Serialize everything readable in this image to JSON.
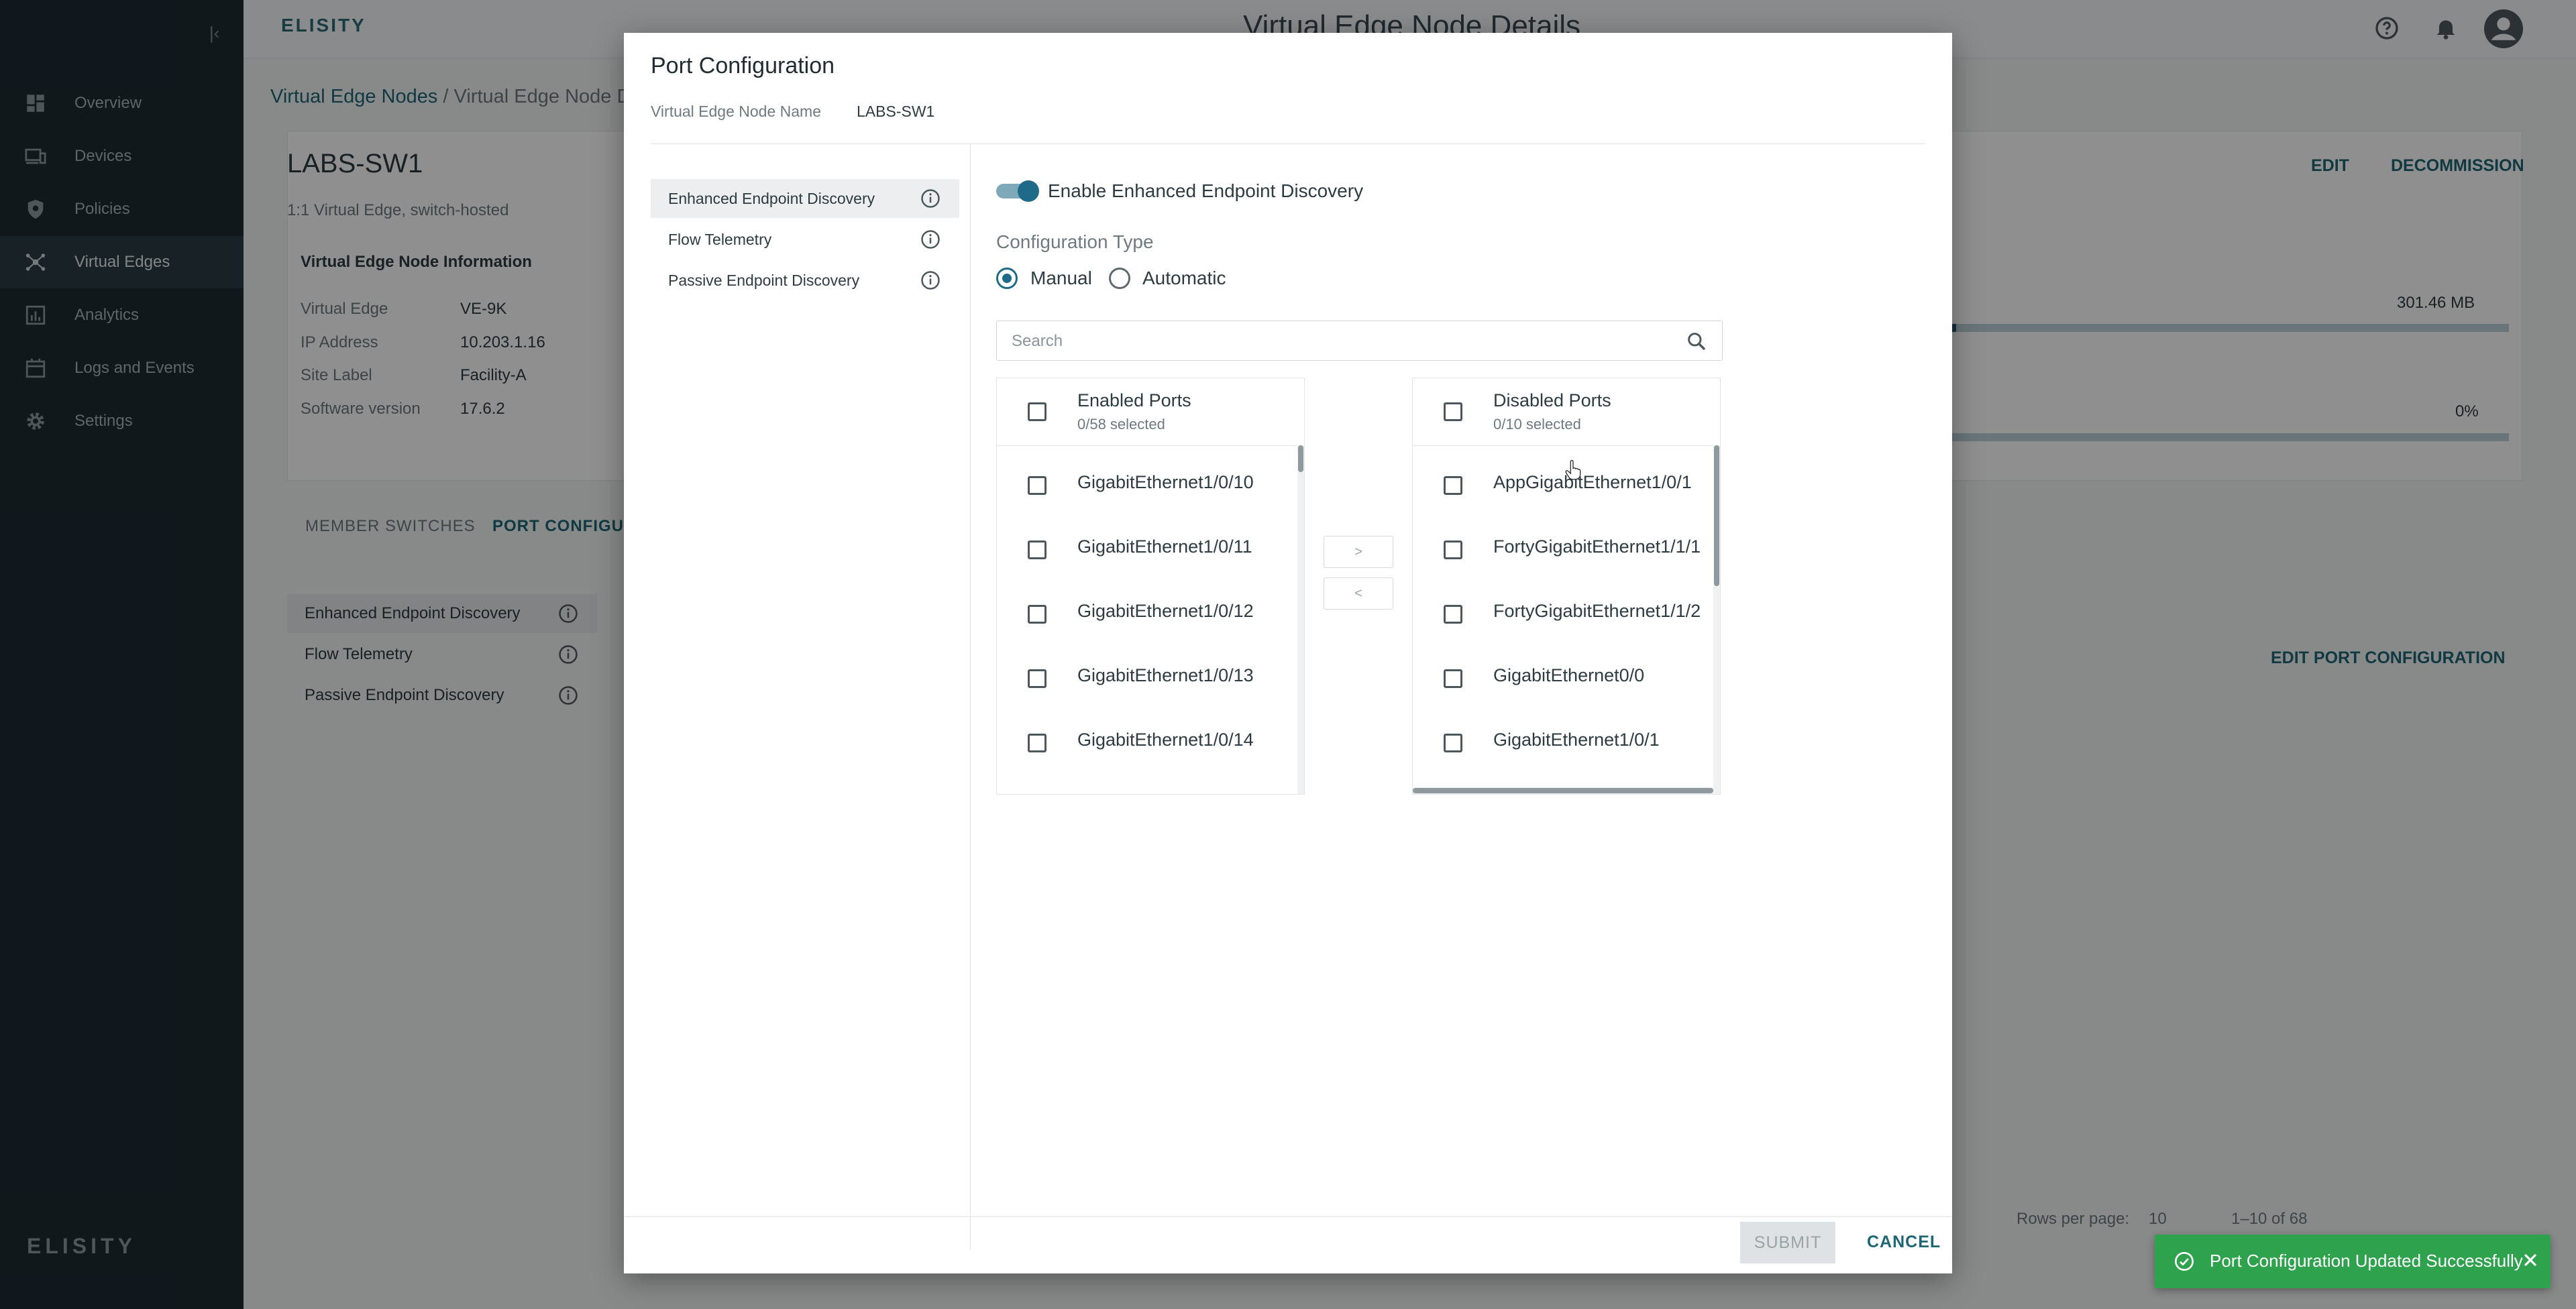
{
  "sidebar": {
    "items": [
      {
        "label": "Overview",
        "icon": "dashboard-icon"
      },
      {
        "label": "Devices",
        "icon": "devices-icon"
      },
      {
        "label": "Policies",
        "icon": "shield-icon"
      },
      {
        "label": "Virtual Edges",
        "icon": "network-icon"
      },
      {
        "label": "Analytics",
        "icon": "analytics-icon"
      },
      {
        "label": "Logs and Events",
        "icon": "calendar-icon"
      },
      {
        "label": "Settings",
        "icon": "gear-icon"
      }
    ],
    "active": "Virtual Edges",
    "logo_text": "ELISITY"
  },
  "header": {
    "brand": "ELISITY",
    "title": "Virtual Edge Node Details"
  },
  "breadcrumb": {
    "root": "Virtual Edge Nodes",
    "current": "Virtual Edge Node D"
  },
  "node": {
    "name": "LABS-SW1",
    "subtitle": "1:1 Virtual Edge, switch-hosted",
    "info_heading": "Virtual Edge Node Information",
    "info": [
      {
        "key": "Virtual Edge",
        "value": "VE-9K"
      },
      {
        "key": "IP Address",
        "value": "10.203.1.16"
      },
      {
        "key": "Site Label",
        "value": "Facility-A"
      },
      {
        "key": "Software version",
        "value": "17.6.2"
      }
    ],
    "edit_label": "EDIT",
    "decommission_label": "DECOMMISSION",
    "memory_value": "301.46 MB",
    "memory_fraction": 0.03,
    "cpu_value": "0%",
    "tabs": [
      "MEMBER SWITCHES",
      "PORT CONFIGURA"
    ],
    "side_items": [
      "Enhanced Endpoint Discovery",
      "Flow Telemetry",
      "Passive Endpoint Discovery"
    ],
    "edit_port_config": "EDIT PORT CONFIGURATION",
    "pager": {
      "rows_label": "Rows per page:",
      "rows_value": "10",
      "range": "1–10 of 68"
    }
  },
  "modal": {
    "title": "Port Configuration",
    "node_name_label": "Virtual Edge Node Name",
    "node_name_value": "LABS-SW1",
    "side_items": [
      "Enhanced Endpoint Discovery",
      "Flow Telemetry",
      "Passive Endpoint Discovery"
    ],
    "toggle_label": "Enable Enhanced Endpoint Discovery",
    "toggle_on": true,
    "config_type_label": "Configuration Type",
    "config_options": [
      "Manual",
      "Automatic"
    ],
    "config_selected": "Manual",
    "search_placeholder": "Search",
    "enabled_ports": {
      "title": "Enabled Ports",
      "count": "0/58 selected",
      "items": [
        "GigabitEthernet1/0/10",
        "GigabitEthernet1/0/11",
        "GigabitEthernet1/0/12",
        "GigabitEthernet1/0/13",
        "GigabitEthernet1/0/14"
      ]
    },
    "disabled_ports": {
      "title": "Disabled Ports",
      "count": "0/10 selected",
      "items": [
        "AppGigabitEthernet1/0/1",
        "FortyGigabitEthernet1/1/1",
        "FortyGigabitEthernet1/1/2",
        "GigabitEthernet0/0",
        "GigabitEthernet1/0/1"
      ]
    },
    "move_right": ">",
    "move_left": "<",
    "submit_label": "SUBMIT",
    "cancel_label": "CANCEL"
  },
  "toast": {
    "message": "Port Configuration Updated Successfully"
  },
  "colors": {
    "sidebar_bg": "#1d2b33",
    "accent": "#1e6676",
    "toggle": "#1e6a88",
    "toast_bg": "#2ea24c"
  }
}
